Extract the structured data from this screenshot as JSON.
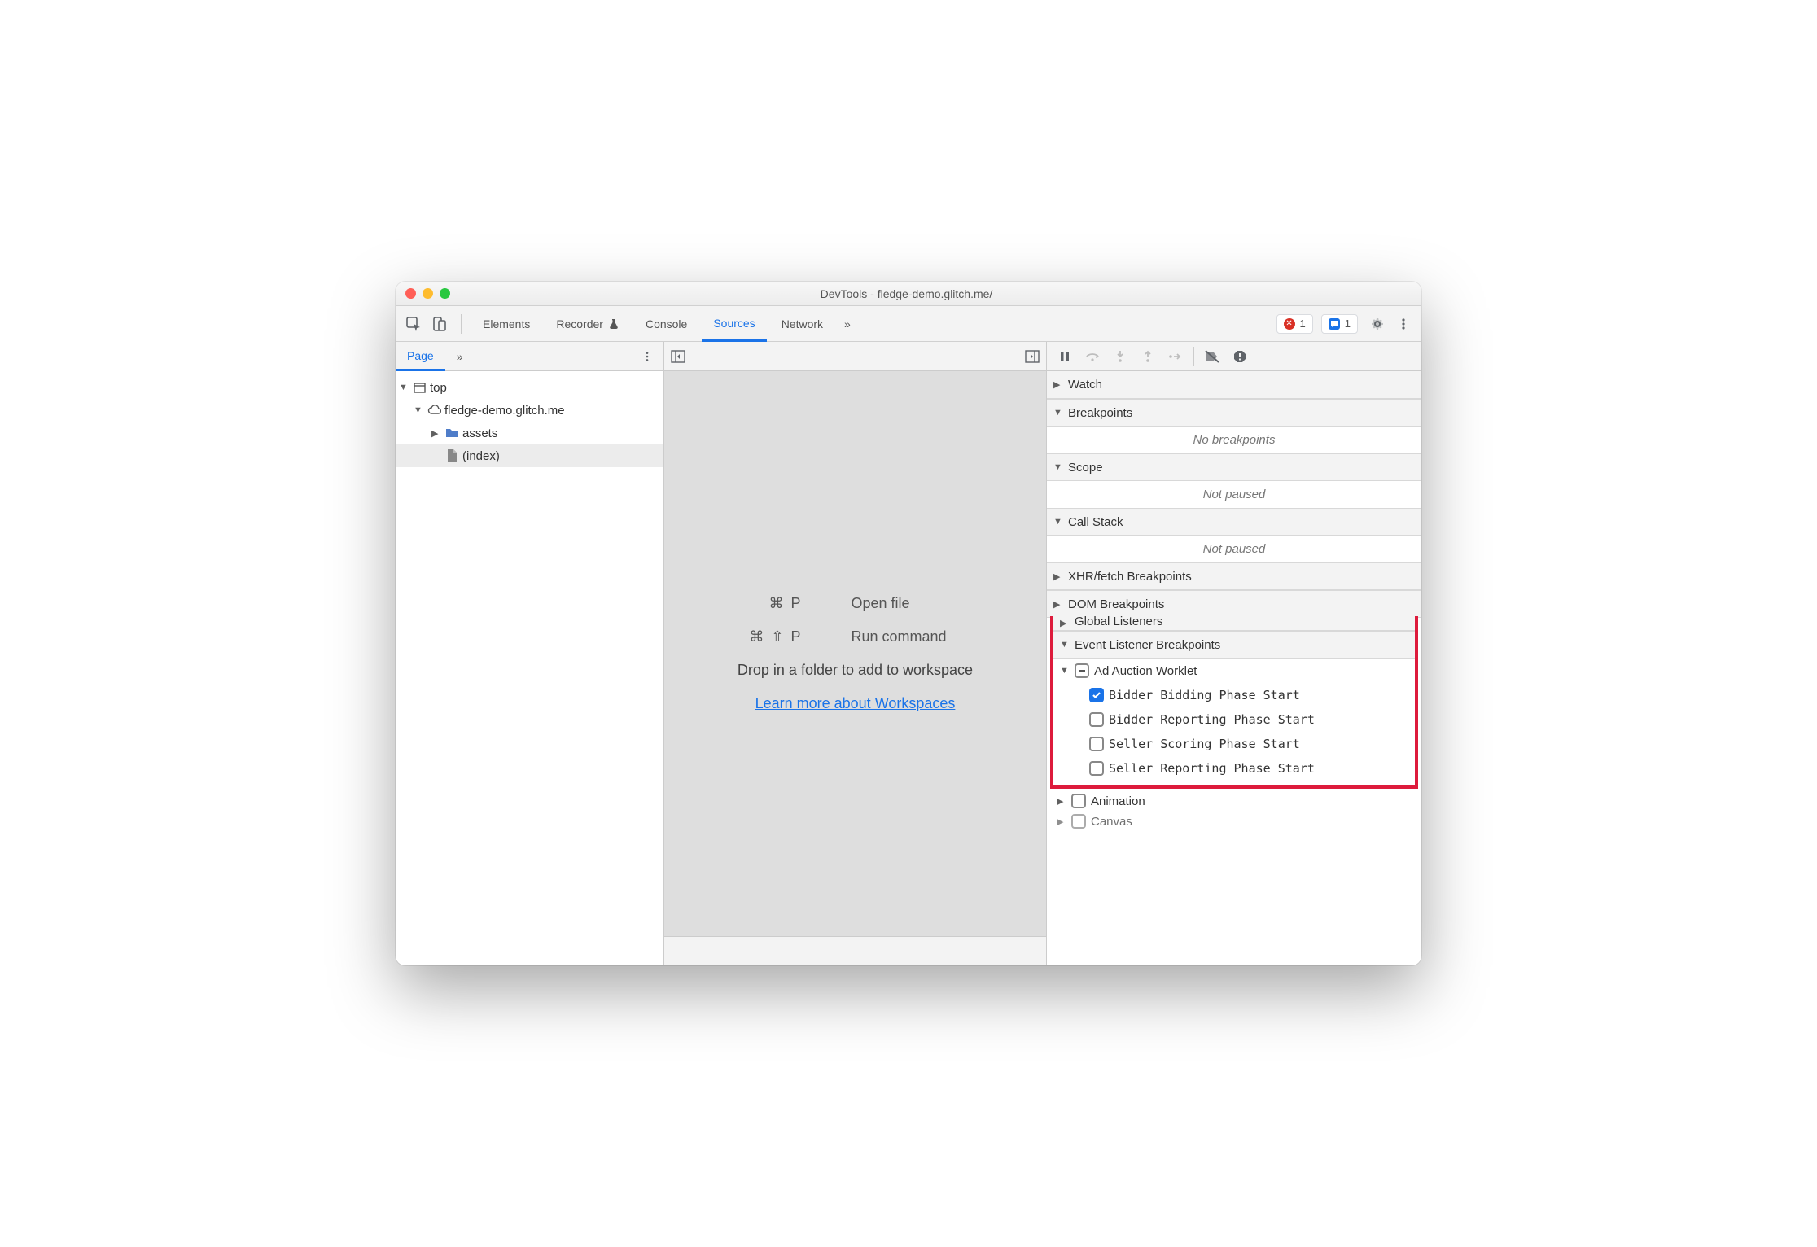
{
  "title": "DevTools - fledge-demo.glitch.me/",
  "tabs": {
    "elements": "Elements",
    "recorder": "Recorder",
    "console": "Console",
    "sources": "Sources",
    "network": "Network"
  },
  "badges": {
    "errors": "1",
    "issues": "1"
  },
  "subtabs": {
    "page": "Page"
  },
  "tree": {
    "top": "top",
    "origin": "fledge-demo.glitch.me",
    "assets": "assets",
    "index": "(index)"
  },
  "mid": {
    "openfile_keys": "⌘ P",
    "openfile": "Open file",
    "runcmd_keys": "⌘ ⇧ P",
    "runcmd": "Run command",
    "drop": "Drop in a folder to add to workspace",
    "link": "Learn more about Workspaces"
  },
  "right": {
    "watch": "Watch",
    "breakpoints": "Breakpoints",
    "no_breakpoints": "No breakpoints",
    "scope": "Scope",
    "not_paused": "Not paused",
    "callstack": "Call Stack",
    "xhr": "XHR/fetch Breakpoints",
    "dom": "DOM Breakpoints",
    "global_listeners": "Global Listeners",
    "elb": "Event Listener Breakpoints",
    "ad_auction": "Ad Auction Worklet",
    "bidder_bidding": "Bidder Bidding Phase Start",
    "bidder_reporting": "Bidder Reporting Phase Start",
    "seller_scoring": "Seller Scoring Phase Start",
    "seller_reporting": "Seller Reporting Phase Start",
    "animation": "Animation",
    "canvas": "Canvas"
  }
}
